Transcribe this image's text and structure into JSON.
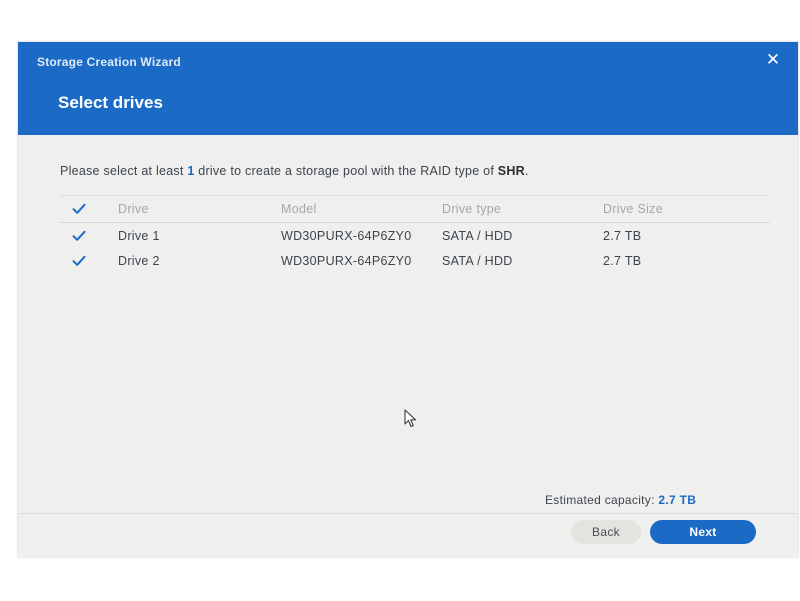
{
  "dialog": {
    "wizard_title": "Storage Creation Wizard",
    "close_glyph": "✕",
    "step_title": "Select drives"
  },
  "instruction": {
    "prefix": "Please select at least ",
    "min_drives": "1",
    "middle": " drive to create a storage pool with the RAID type of ",
    "raid_type": "SHR",
    "suffix": "."
  },
  "table": {
    "headers": {
      "drive": "Drive",
      "model": "Model",
      "drive_type": "Drive type",
      "drive_size": "Drive Size"
    },
    "select_all_checked": true,
    "rows": [
      {
        "checked": true,
        "drive": "Drive 1",
        "model": "WD30PURX-64P6ZY0",
        "drive_type": "SATA / HDD",
        "drive_size": "2.7 TB"
      },
      {
        "checked": true,
        "drive": "Drive 2",
        "model": "WD30PURX-64P6ZY0",
        "drive_type": "SATA / HDD",
        "drive_size": "2.7 TB"
      }
    ]
  },
  "footer": {
    "capacity_label": "Estimated capacity: ",
    "capacity_value": "2.7 TB",
    "back_label": "Back",
    "next_label": "Next"
  },
  "icons": {
    "check": "check-icon",
    "close": "close-icon",
    "cursor": "mouse-cursor-icon"
  },
  "colors": {
    "accent": "#1b6bc6",
    "panel": "#efefed"
  }
}
